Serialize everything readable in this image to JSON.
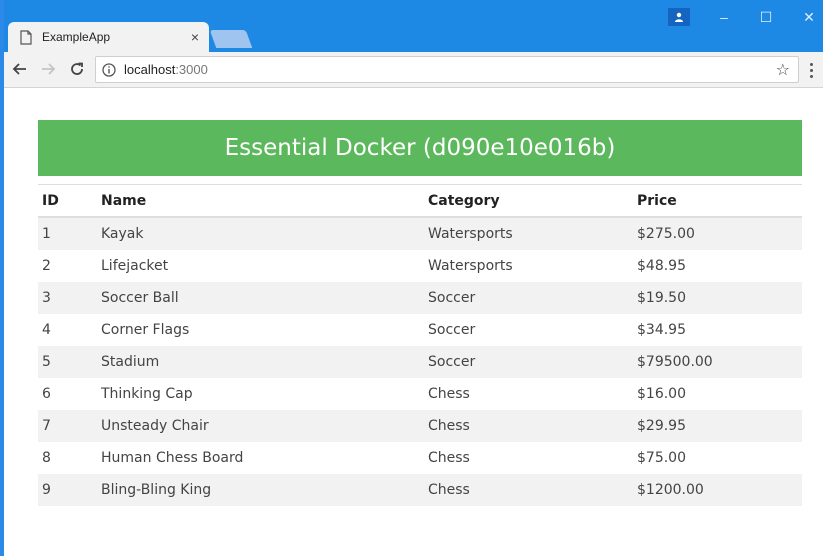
{
  "browser": {
    "tab_title": "ExampleApp",
    "tab_close": "×",
    "url_host": "localhost",
    "url_port": ":3000",
    "controls": {
      "minimize": "–",
      "maximize": "☐",
      "close": "✕"
    }
  },
  "page": {
    "heading": "Essential Docker (d090e10e016b)",
    "columns": [
      "ID",
      "Name",
      "Category",
      "Price"
    ],
    "rows": [
      {
        "id": "1",
        "name": "Kayak",
        "category": "Watersports",
        "price": "$275.00"
      },
      {
        "id": "2",
        "name": "Lifejacket",
        "category": "Watersports",
        "price": "$48.95"
      },
      {
        "id": "3",
        "name": "Soccer Ball",
        "category": "Soccer",
        "price": "$19.50"
      },
      {
        "id": "4",
        "name": "Corner Flags",
        "category": "Soccer",
        "price": "$34.95"
      },
      {
        "id": "5",
        "name": "Stadium",
        "category": "Soccer",
        "price": "$79500.00"
      },
      {
        "id": "6",
        "name": "Thinking Cap",
        "category": "Chess",
        "price": "$16.00"
      },
      {
        "id": "7",
        "name": "Unsteady Chair",
        "category": "Chess",
        "price": "$29.95"
      },
      {
        "id": "8",
        "name": "Human Chess Board",
        "category": "Chess",
        "price": "$75.00"
      },
      {
        "id": "9",
        "name": "Bling-Bling King",
        "category": "Chess",
        "price": "$1200.00"
      }
    ]
  },
  "colors": {
    "titlebar": "#1e88e5",
    "banner": "#5cb85c",
    "stripe": "#f2f2f2"
  }
}
